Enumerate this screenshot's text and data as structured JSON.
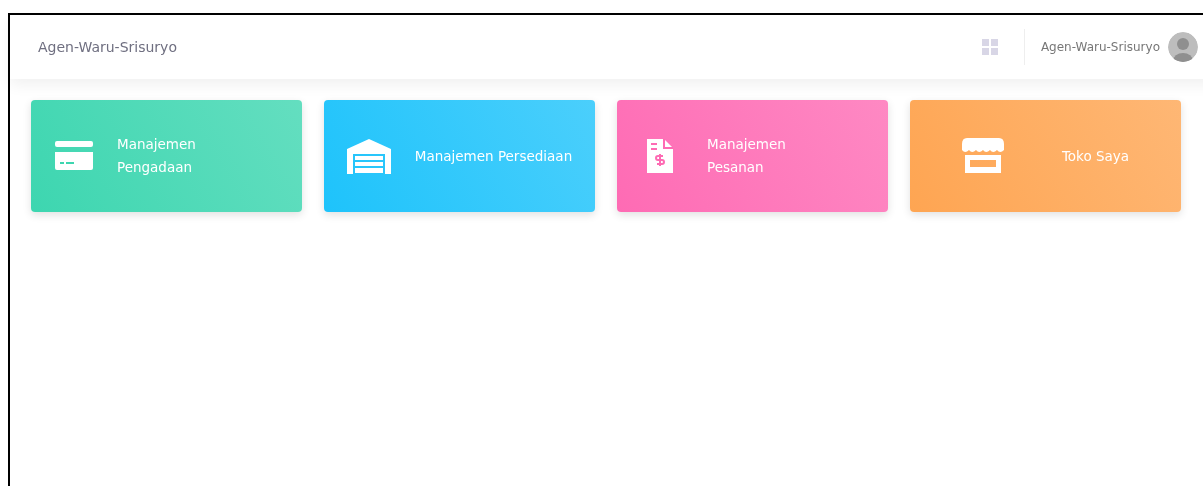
{
  "header": {
    "brand": "Agen-Waru-Srisuryo",
    "user_name": "Agen-Waru-Srisuryo"
  },
  "cards": [
    {
      "kind": "card",
      "label": "Manajemen Pengadaan",
      "color": "#3dd6b0"
    },
    {
      "kind": "warehouse",
      "label": "Manajemen Persediaan",
      "color": "#1ec3fb"
    },
    {
      "kind": "invoice",
      "label": "Manajemen Pesanan",
      "color": "#fe6bb4"
    },
    {
      "kind": "store",
      "label": "Toko Saya",
      "color": "#fea552"
    }
  ]
}
